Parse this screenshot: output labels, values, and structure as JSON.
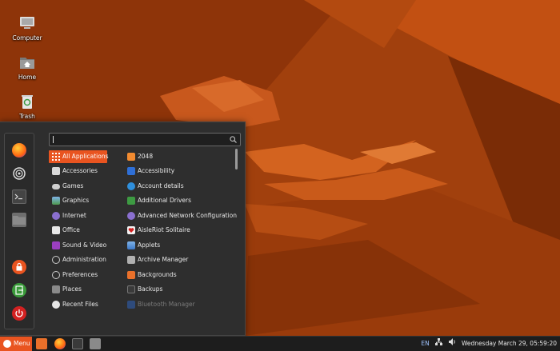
{
  "desktop": {
    "icons": [
      {
        "label": "Computer",
        "icon": "computer-icon"
      },
      {
        "label": "Home",
        "icon": "home-folder-icon"
      },
      {
        "label": "Trash",
        "icon": "trash-icon"
      }
    ]
  },
  "menu": {
    "search": {
      "value": "",
      "icon": "search-icon"
    },
    "favorites": [
      {
        "icon": "firefox-icon",
        "color": "#ff6611"
      },
      {
        "icon": "settings-icon",
        "color": "#cccccc"
      },
      {
        "icon": "terminal-icon",
        "color": "#333333"
      },
      {
        "icon": "files-icon",
        "color": "#777777"
      },
      {
        "icon": "lock-screen-icon",
        "color": "#e95420"
      },
      {
        "icon": "logout-icon",
        "color": "#3a9a3a"
      },
      {
        "icon": "shutdown-icon",
        "color": "#d32121"
      }
    ],
    "categories": [
      {
        "label": "All Applications",
        "icon": "grid-icon",
        "active": true
      },
      {
        "label": "Accessories",
        "icon": "accessories-icon"
      },
      {
        "label": "Games",
        "icon": "games-icon"
      },
      {
        "label": "Graphics",
        "icon": "graphics-icon"
      },
      {
        "label": "Internet",
        "icon": "internet-icon"
      },
      {
        "label": "Office",
        "icon": "office-icon"
      },
      {
        "label": "Sound & Video",
        "icon": "multimedia-icon"
      },
      {
        "label": "Administration",
        "icon": "administration-icon"
      },
      {
        "label": "Preferences",
        "icon": "preferences-icon"
      },
      {
        "label": "Places",
        "icon": "places-folder-icon"
      },
      {
        "label": "Recent Files",
        "icon": "recent-files-icon"
      }
    ],
    "applications": [
      {
        "label": "2048",
        "icon": "2048-icon",
        "color": "#f28b30"
      },
      {
        "label": "Accessibility",
        "icon": "accessibility-icon",
        "color": "#2f6fd6"
      },
      {
        "label": "Account details",
        "icon": "account-icon",
        "color": "#2f8fdc"
      },
      {
        "label": "Additional Drivers",
        "icon": "drivers-icon",
        "color": "#3d9a42"
      },
      {
        "label": "Advanced Network Configuration",
        "icon": "network-icon",
        "color": "#8a6fcf"
      },
      {
        "label": "AisleRiot Solitaire",
        "icon": "cards-icon",
        "color": "#f2f2f2"
      },
      {
        "label": "Applets",
        "icon": "applets-icon",
        "color": "#5a8fd6"
      },
      {
        "label": "Archive Manager",
        "icon": "archive-icon",
        "color": "#b0b0b0"
      },
      {
        "label": "Backgrounds",
        "icon": "backgrounds-icon",
        "color": "#e9702a"
      },
      {
        "label": "Backups",
        "icon": "backups-icon",
        "color": "#3a3a3a"
      },
      {
        "label": "Bluetooth Manager",
        "icon": "bluetooth-icon",
        "color": "#2f5fb0",
        "dim": true
      }
    ]
  },
  "taskbar": {
    "menu_label": "Menu",
    "pinned": [
      {
        "icon": "files-icon"
      },
      {
        "icon": "firefox-icon"
      },
      {
        "icon": "terminal-icon"
      },
      {
        "icon": "folder-icon"
      }
    ],
    "tray": {
      "language": "EN",
      "network_icon": "network-wired-icon",
      "volume_icon": "volume-icon",
      "clock": "Wednesday March 29, 05:59:20"
    }
  },
  "colors": {
    "accent": "#e95420",
    "wallpaper": "#a5410e",
    "menu_bg": "#2e2e2e",
    "panel_bg": "#1d1d1d"
  }
}
